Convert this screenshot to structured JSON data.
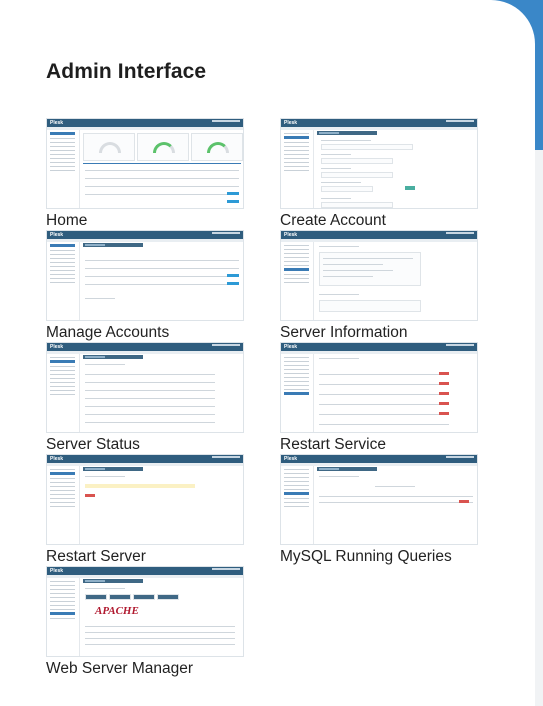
{
  "page": {
    "title": "Admin Interface"
  },
  "items": [
    {
      "label": "Home"
    },
    {
      "label": "Create Account"
    },
    {
      "label": "Manage Accounts"
    },
    {
      "label": "Server Information"
    },
    {
      "label": "Server Status"
    },
    {
      "label": "Restart Service"
    },
    {
      "label": "Restart Server"
    },
    {
      "label": "MySQL Running Queries"
    },
    {
      "label": "Web Server Manager"
    }
  ],
  "thumbnail": {
    "logo": "Plesk",
    "apache_logo": "APACHE"
  },
  "colors": {
    "background_accent": "#3a87c8",
    "thumbnail_header": "#2f5d7e",
    "button_blue": "#2d9ad6",
    "button_red": "#d9534f"
  }
}
